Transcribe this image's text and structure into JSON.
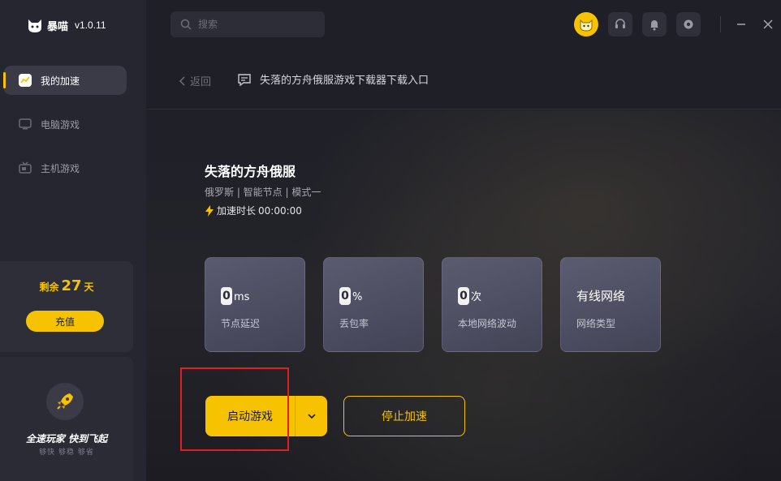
{
  "app": {
    "name": "暴喵",
    "version": "v1.0.11"
  },
  "sidebar": {
    "items": [
      {
        "label": "我的加速",
        "icon": "chart-card-icon",
        "active": true
      },
      {
        "label": "电脑游戏",
        "icon": "monitor-icon",
        "active": false
      },
      {
        "label": "主机游戏",
        "icon": "console-icon",
        "active": false
      }
    ],
    "days": {
      "prefix": "剩余",
      "value": "27",
      "suffix": "天"
    },
    "recharge_label": "充值",
    "promo": {
      "title": "全速玩家  快到飞起",
      "subtitle": "够快  够稳  够省"
    }
  },
  "search": {
    "placeholder": "搜索"
  },
  "header": {
    "back_label": "返回",
    "title": "失落的方舟俄服游戏下载器下载入口"
  },
  "game": {
    "name": "失落的方舟俄服",
    "meta": "俄罗斯 | 智能节点 | 模式一",
    "duration_label": "加速时长",
    "duration_value": "00:00:00"
  },
  "stats": [
    {
      "value": "0",
      "unit": "ms",
      "label": "节点延迟"
    },
    {
      "value": "0",
      "unit": "%",
      "label": "丢包率"
    },
    {
      "value": "0",
      "unit": "次",
      "label": "本地网络波动"
    },
    {
      "value": "有线网络",
      "unit": "",
      "label": "网络类型"
    }
  ],
  "actions": {
    "start_label": "启动游戏",
    "stop_label": "停止加速"
  },
  "colors": {
    "accent": "#f7c300",
    "background": "#1e1f27",
    "sidebar": "#25262f",
    "highlight": "#e02020"
  }
}
